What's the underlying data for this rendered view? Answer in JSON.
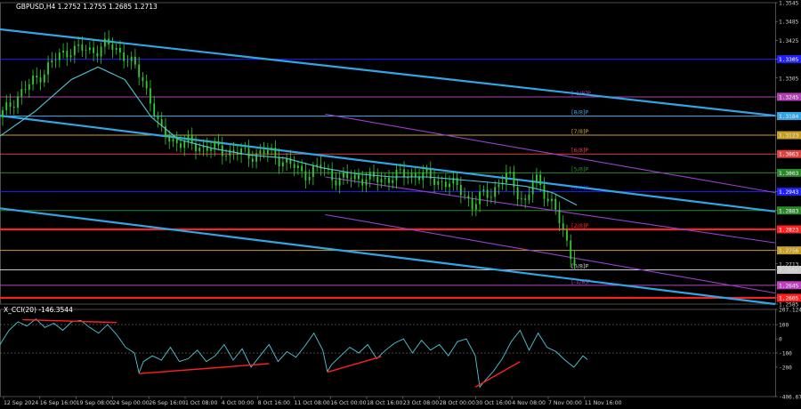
{
  "chart_data": [
    {
      "type": "candlestick",
      "title": "GBPUSD,H4  1.2752 1.2755 1.2685 1.2713",
      "symbol": "GBPUSD",
      "timeframe": "H4",
      "ohlc_last": {
        "open": 1.2752,
        "high": 1.2755,
        "low": 1.2685,
        "close": 1.2713
      },
      "ylim": [
        1.2585,
        1.3545
      ],
      "y_ticks": [
        "1.3545",
        "1.3485",
        "1.3425",
        "1.3365",
        "1.3305",
        "1.3245",
        "1.3184",
        "1.3123",
        "1.3063",
        "1.3003",
        "1.2943",
        "1.2883",
        "1.2823",
        "1.2756",
        "1.2713",
        "1.2694",
        "1.2645",
        "1.2605",
        "1.2585"
      ],
      "x_ticks": [
        "12 Sep 2024",
        "16 Sep 16:00",
        "19 Sep 08:00",
        "24 Sep 00:00",
        "26 Sep 16:00",
        "1 Oct 08:00",
        "4 Oct 00:00",
        "8 Oct 16:00",
        "11 Oct 08:00",
        "16 Oct 00:00",
        "18 Oct 16:00",
        "23 Oct 08:00",
        "28 Oct 00:00",
        "30 Oct 16:00",
        "4 Nov 08:00",
        "7 Nov 00:00",
        "11 Nov 16:00"
      ],
      "price_path": [
        [
          0,
          1.318
        ],
        [
          4,
          1.325
        ],
        [
          8,
          1.33
        ],
        [
          12,
          1.336
        ],
        [
          16,
          1.34
        ],
        [
          20,
          1.339
        ],
        [
          24,
          1.341
        ],
        [
          28,
          1.338
        ],
        [
          32,
          1.33
        ],
        [
          34,
          1.323
        ],
        [
          36,
          1.313
        ],
        [
          40,
          1.31
        ],
        [
          44,
          1.309
        ],
        [
          48,
          1.308
        ],
        [
          52,
          1.307
        ],
        [
          56,
          1.306
        ],
        [
          60,
          1.307
        ],
        [
          64,
          1.304
        ],
        [
          68,
          1.3
        ],
        [
          72,
          1.302
        ],
        [
          76,
          1.298
        ],
        [
          80,
          1.299
        ],
        [
          84,
          1.298
        ],
        [
          88,
          1.299
        ],
        [
          92,
          1.3
        ],
        [
          96,
          1.299
        ],
        [
          100,
          1.297
        ],
        [
          104,
          1.295
        ],
        [
          106,
          1.289
        ],
        [
          108,
          1.293
        ],
        [
          112,
          1.296
        ],
        [
          114,
          1.3
        ],
        [
          116,
          1.295
        ],
        [
          118,
          1.29
        ],
        [
          120,
          1.299
        ],
        [
          122,
          1.295
        ],
        [
          124,
          1.29
        ],
        [
          126,
          1.283
        ],
        [
          128,
          1.275
        ],
        [
          129.5,
          1.2713
        ]
      ],
      "ma_path": [
        [
          0,
          1.312
        ],
        [
          8,
          1.32
        ],
        [
          16,
          1.33
        ],
        [
          22,
          1.334
        ],
        [
          28,
          1.33
        ],
        [
          34,
          1.318
        ],
        [
          40,
          1.311
        ],
        [
          48,
          1.308
        ],
        [
          56,
          1.306
        ],
        [
          64,
          1.305
        ],
        [
          72,
          1.302
        ],
        [
          80,
          1.3
        ],
        [
          88,
          1.299
        ],
        [
          96,
          1.299
        ],
        [
          104,
          1.298
        ],
        [
          112,
          1.297
        ],
        [
          118,
          1.296
        ],
        [
          124,
          1.294
        ],
        [
          129.5,
          1.29
        ]
      ],
      "channels": [
        {
          "color": "#2fa6e6",
          "points": [
            [
              0,
              1.346
            ],
            [
              174,
              1.3185
            ]
          ]
        },
        {
          "color": "#2fa6e6",
          "points": [
            [
              0,
              1.3185
            ],
            [
              174,
              1.288
            ]
          ]
        },
        {
          "color": "#2fa6e6",
          "points": [
            [
              0,
              1.289
            ],
            [
              174,
              1.2585
            ]
          ]
        },
        {
          "color": "#9b3fd0",
          "points": [
            [
              73,
              1.319
            ],
            [
              174,
              1.294
            ]
          ]
        },
        {
          "color": "#9b3fd0",
          "points": [
            [
              73,
              1.299
            ],
            [
              174,
              1.278
            ]
          ]
        },
        {
          "color": "#9b3fd0",
          "points": [
            [
              73,
              1.287
            ],
            [
              174,
              1.262
            ]
          ]
        }
      ],
      "levels": [
        {
          "price": 1.3365,
          "color": "#2020ff",
          "label": "",
          "price_label": "1.3305"
        },
        {
          "price": 1.3245,
          "color": "#b03fb0",
          "label": "[-1/8]P",
          "price_label": "1.3245"
        },
        {
          "price": 1.3184,
          "color": "#2fa6e6",
          "label": "[8/8]P",
          "price_label": "1.3184"
        },
        {
          "price": 1.3123,
          "color": "#c8a020",
          "label": "[7/8]P",
          "price_label": "1.3123"
        },
        {
          "price": 1.3063,
          "color": "#e04040",
          "label": "[6/8]P",
          "price_label": "1.3063"
        },
        {
          "price": 1.3003,
          "color": "#2a8a2a",
          "label": "[5/8]P",
          "price_label": "1.3003"
        },
        {
          "price": 1.2943,
          "color": "#2020ff",
          "label": "[4/8]P",
          "price_label": "1.2943"
        },
        {
          "price": 1.2883,
          "color": "#2a8a2a",
          "label": "",
          "price_label": "1.2883"
        },
        {
          "price": 1.2823,
          "color": "#ff2020",
          "label": "[2/8]P",
          "price_label": "1.2823",
          "thick": true
        },
        {
          "price": 1.2756,
          "color": "#c8a020",
          "label": "",
          "price_label": "1.2756"
        },
        {
          "price": 1.2694,
          "color": "#cccccc",
          "label": "[0/8]P",
          "price_label": "1.2694"
        },
        {
          "price": 1.2645,
          "color": "#c040c0",
          "label": "[-1/8]P",
          "price_label": "1.2645"
        },
        {
          "price": 1.2605,
          "color": "#ff2020",
          "label": "",
          "price_label": "1.2605",
          "thick": true
        }
      ]
    },
    {
      "type": "line",
      "title": "X_CCI(20) -146.3544",
      "indicator": "CCI",
      "period": 20,
      "last_value": -146.3544,
      "ylim": [
        -406.677,
        207.1248
      ],
      "y_ticks": [
        "207.1248",
        "100",
        "0",
        "-100",
        "-200",
        "-406.677"
      ],
      "levels": [
        100,
        -100
      ],
      "values": [
        [
          0,
          -40
        ],
        [
          2,
          60
        ],
        [
          4,
          120
        ],
        [
          6,
          90
        ],
        [
          8,
          140
        ],
        [
          10,
          80
        ],
        [
          12,
          110
        ],
        [
          14,
          60
        ],
        [
          16,
          120
        ],
        [
          18,
          130
        ],
        [
          20,
          80
        ],
        [
          22,
          40
        ],
        [
          24,
          100
        ],
        [
          26,
          30
        ],
        [
          28,
          -60
        ],
        [
          30,
          -100
        ],
        [
          31,
          -240
        ],
        [
          32,
          -160
        ],
        [
          34,
          -120
        ],
        [
          36,
          -150
        ],
        [
          38,
          -60
        ],
        [
          40,
          -160
        ],
        [
          42,
          -140
        ],
        [
          44,
          -80
        ],
        [
          46,
          -160
        ],
        [
          48,
          -120
        ],
        [
          50,
          -40
        ],
        [
          52,
          -150
        ],
        [
          54,
          -70
        ],
        [
          56,
          -200
        ],
        [
          58,
          -120
        ],
        [
          60,
          -40
        ],
        [
          62,
          -160
        ],
        [
          64,
          -90
        ],
        [
          66,
          -130
        ],
        [
          68,
          -50
        ],
        [
          70,
          40
        ],
        [
          72,
          -80
        ],
        [
          73,
          -230
        ],
        [
          74,
          -180
        ],
        [
          76,
          -120
        ],
        [
          78,
          -60
        ],
        [
          80,
          -100
        ],
        [
          82,
          -40
        ],
        [
          84,
          -140
        ],
        [
          86,
          -80
        ],
        [
          88,
          -30
        ],
        [
          90,
          0
        ],
        [
          92,
          -100
        ],
        [
          94,
          -10
        ],
        [
          96,
          -80
        ],
        [
          98,
          -40
        ],
        [
          100,
          -120
        ],
        [
          102,
          -20
        ],
        [
          104,
          0
        ],
        [
          106,
          -120
        ],
        [
          107,
          -340
        ],
        [
          108,
          -300
        ],
        [
          110,
          -230
        ],
        [
          112,
          -140
        ],
        [
          114,
          -20
        ],
        [
          116,
          60
        ],
        [
          118,
          -80
        ],
        [
          120,
          40
        ],
        [
          122,
          -60
        ],
        [
          124,
          -90
        ],
        [
          126,
          -150
        ],
        [
          128,
          -200
        ],
        [
          130,
          -120
        ],
        [
          131,
          -146
        ]
      ],
      "divergence_lines": [
        {
          "points": [
            [
              5,
              135
            ],
            [
              26,
              115
            ]
          ]
        },
        {
          "points": [
            [
              31,
              -245
            ],
            [
              60,
              -175
            ]
          ]
        },
        {
          "points": [
            [
              73,
              -235
            ],
            [
              85,
              -125
            ]
          ]
        },
        {
          "points": [
            [
              106,
              -340
            ],
            [
              116,
              -160
            ]
          ]
        }
      ]
    }
  ]
}
